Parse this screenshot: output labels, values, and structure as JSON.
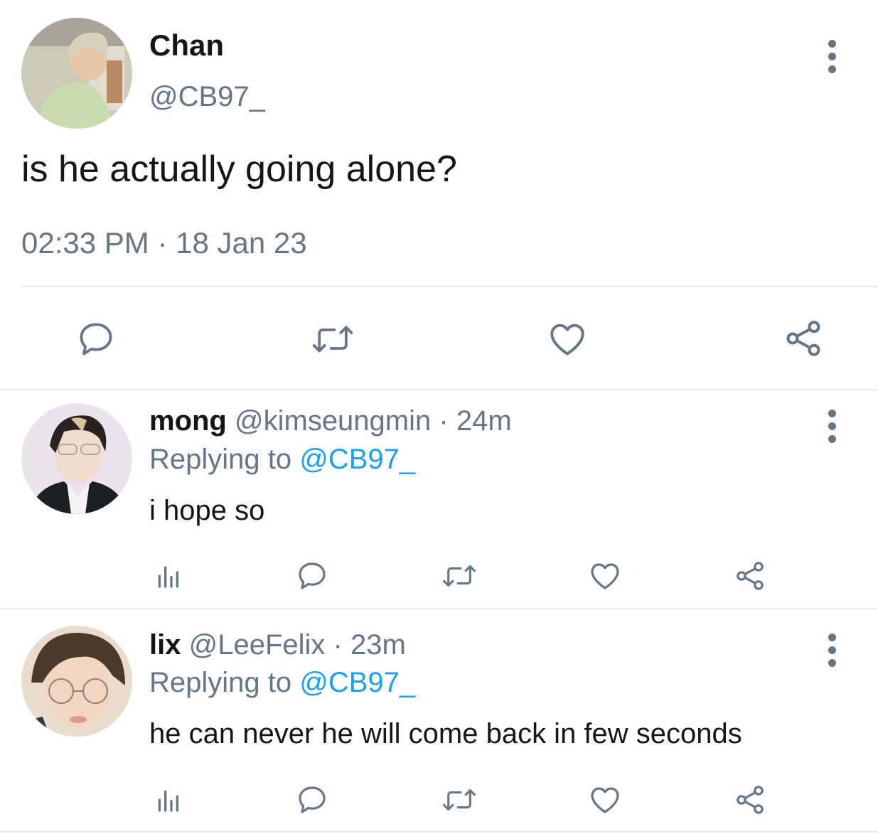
{
  "tweet": {
    "author_name": "Chan",
    "author_handle": "@CB97_",
    "text": "is he actually going alone?",
    "timestamp": "02:33 PM · 18 Jan 23",
    "actions": [
      "reply-icon",
      "retweet-icon",
      "like-icon",
      "share-icon"
    ]
  },
  "replies": [
    {
      "name": "mong",
      "handle": "@kimseungmin",
      "sep": "·",
      "time": "24m",
      "replying_label": "Replying to",
      "replying_to": "@CB97_",
      "text": "i hope so"
    },
    {
      "name": "lix",
      "handle": "@LeeFelix",
      "sep": "·",
      "time": "23m",
      "replying_label": "Replying to",
      "replying_to": "@CB97_",
      "text": "he can never he will come back in few seconds"
    }
  ],
  "colors": {
    "text": "#14171a",
    "secondary": "#657786",
    "accent": "#1da1f2",
    "divider": "#e6ecf0"
  }
}
